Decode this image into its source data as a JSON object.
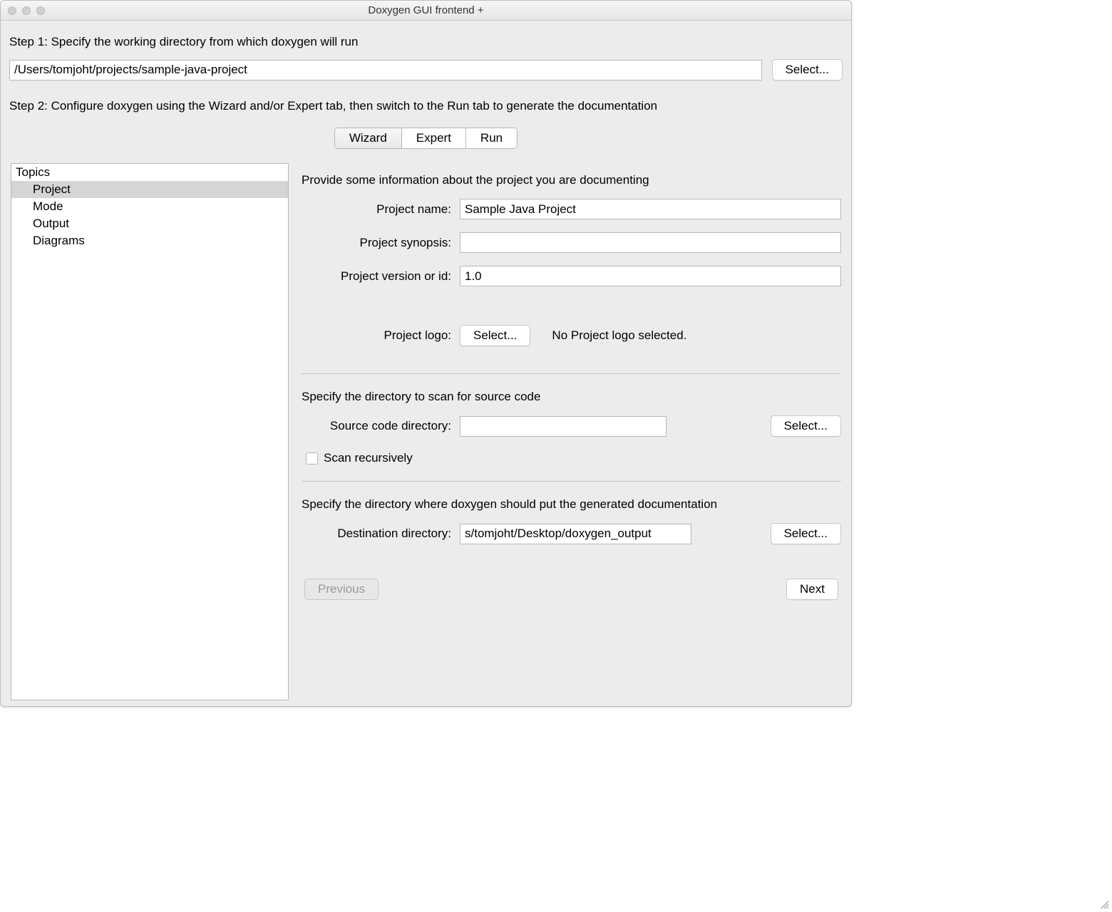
{
  "window": {
    "title": "Doxygen GUI frontend +"
  },
  "step1": {
    "label": "Step 1: Specify the working directory from which doxygen will run",
    "working_dir": "/Users/tomjoht/projects/sample-java-project",
    "select_label": "Select..."
  },
  "step2": {
    "label": "Step 2: Configure doxygen using the Wizard and/or Expert tab, then switch to the Run tab to generate the documentation"
  },
  "tabs": {
    "wizard": "Wizard",
    "expert": "Expert",
    "run": "Run"
  },
  "topics": {
    "header": "Topics",
    "items": [
      "Project",
      "Mode",
      "Output",
      "Diagrams"
    ]
  },
  "wizard": {
    "intro": "Provide some information about the project you are documenting",
    "project_name_label": "Project name:",
    "project_name": "Sample Java Project",
    "synopsis_label": "Project synopsis:",
    "synopsis": "",
    "version_label": "Project version or id:",
    "version": "1.0",
    "logo_label": "Project logo:",
    "logo_select": "Select...",
    "logo_status": "No Project logo selected.",
    "source_section": "Specify the directory to scan for source code",
    "source_dir_label": "Source code directory:",
    "source_dir": "",
    "source_select": "Select...",
    "scan_recursively": "Scan recursively",
    "dest_section": "Specify the directory where doxygen should put the generated documentation",
    "dest_dir_label": "Destination directory:",
    "dest_dir": "s/tomjoht/Desktop/doxygen_output",
    "dest_select": "Select...",
    "prev": "Previous",
    "next": "Next"
  }
}
